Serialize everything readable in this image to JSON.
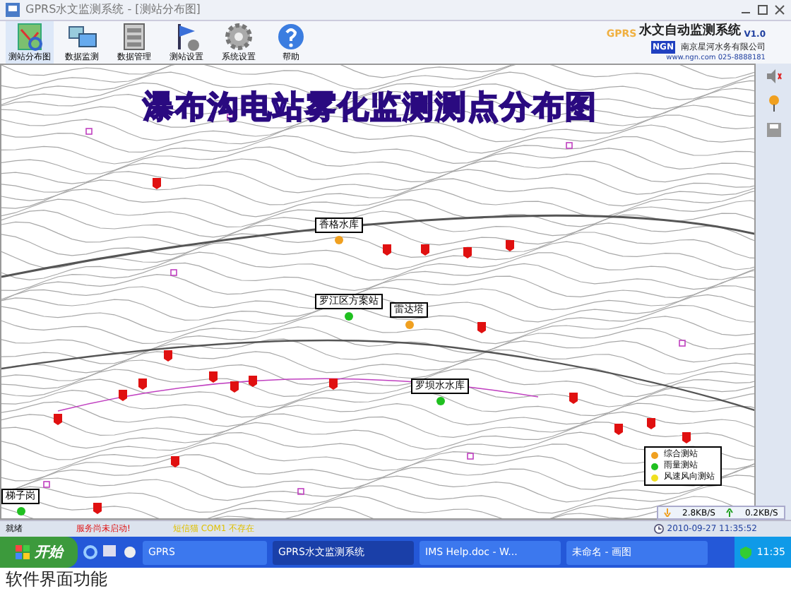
{
  "window": {
    "title": "GPRS水文监测系统 - [测站分布图]"
  },
  "toolbar": [
    {
      "label": "测站分布图",
      "kind": "map"
    },
    {
      "label": "数据监测",
      "kind": "monitor"
    },
    {
      "label": "数据管理",
      "kind": "data"
    },
    {
      "label": "测站设置",
      "kind": "station"
    },
    {
      "label": "系统设置",
      "kind": "settings"
    },
    {
      "label": "帮助",
      "kind": "help"
    }
  ],
  "brand": {
    "product_prefix": "GPRS",
    "product": "水文自动监测系统",
    "version": "V1.0",
    "logo": "NGN",
    "company": "南京星河水务有限公司",
    "contact": "www.ngn.com  025-8888181"
  },
  "map": {
    "title": "瀑布沟电站雾化监测测点分布图",
    "stations": [
      {
        "name": "香格水库",
        "color": "#f0a020"
      },
      {
        "name": "罗江区方案站",
        "color": "#20c020"
      },
      {
        "name": "雷达塔",
        "color": "#f0a020"
      },
      {
        "name": "罗坝水水库",
        "color": "#20c020"
      },
      {
        "name": "梯子岗",
        "color": "#20c020"
      }
    ],
    "legend": [
      {
        "label": "综合测站",
        "color": "#f0a020"
      },
      {
        "label": "雨量测站",
        "color": "#20c020"
      },
      {
        "label": "风速风向测站",
        "color": "#f0e020"
      }
    ],
    "traffic": {
      "down": "2.8KB/S",
      "up": "0.2KB/S"
    }
  },
  "status_bar": {
    "state": "就绪",
    "service": "服务尚未启动!",
    "modem": "短信猫 COM1 不存在",
    "time": "2010-09-27 11:35:52"
  },
  "taskbar": {
    "start": "开始",
    "windows": [
      {
        "label": "GPRS",
        "selected": false
      },
      {
        "label": "GPRS水文监测系统",
        "selected": true
      },
      {
        "label": "IMS Help.doc - W...",
        "selected": false
      },
      {
        "label": "未命名 - 画图",
        "selected": false
      }
    ],
    "clock": "11:35"
  },
  "caption": "软件界面功能"
}
